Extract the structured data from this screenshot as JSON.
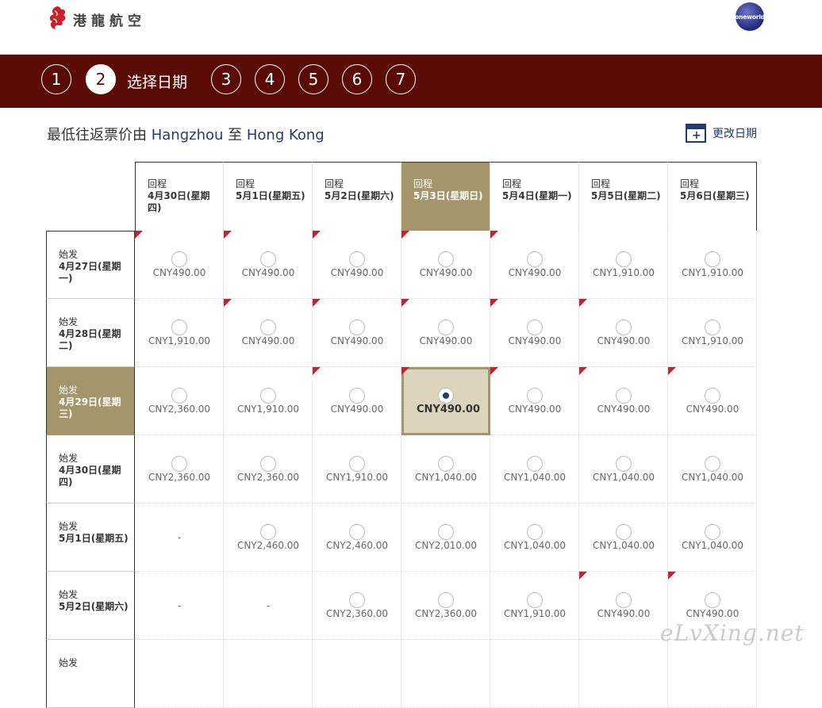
{
  "header": {
    "logo_text": "港龍航空",
    "alliance_badge": "oneworld"
  },
  "steps": {
    "items": [
      "1",
      "2",
      "3",
      "4",
      "5",
      "6",
      "7"
    ],
    "active_index": 1,
    "active_label": "选择日期"
  },
  "subtitle": {
    "prefix": "最低往返票价由 ",
    "origin": "Hangzhou",
    "middle": " 至 ",
    "destination": "Hong Kong"
  },
  "change_date": {
    "label": "更改日期",
    "icon": "calendar-plus-icon"
  },
  "grid": {
    "return_label": "回程",
    "depart_label": "始发",
    "return_dates": [
      "4月30日(星期四)",
      "5月1日(星期五)",
      "5月2日(星期六)",
      "5月3日(星期日)",
      "5月4日(星期一)",
      "5月5日(星期二)",
      "5月6日(星期三)"
    ],
    "depart_dates": [
      "4月27日(星期一)",
      "4月28日(星期二)",
      "4月29日(星期三)",
      "4月30日(星期四)",
      "5月1日(星期五)",
      "5月2日(星期六)",
      ""
    ],
    "selected_return_col": 3,
    "selected_depart_row": 2,
    "prices": [
      [
        "CNY490.00",
        "CNY490.00",
        "CNY490.00",
        "CNY490.00",
        "CNY490.00",
        "CNY1,910.00",
        "CNY1,910.00"
      ],
      [
        "CNY1,910.00",
        "CNY490.00",
        "CNY490.00",
        "CNY490.00",
        "CNY490.00",
        "CNY490.00",
        "CNY1,910.00"
      ],
      [
        "CNY2,360.00",
        "CNY1,910.00",
        "CNY490.00",
        "CNY490.00",
        "CNY490.00",
        "CNY490.00",
        "CNY490.00"
      ],
      [
        "CNY2,360.00",
        "CNY2,360.00",
        "CNY1,910.00",
        "CNY1,040.00",
        "CNY1,040.00",
        "CNY1,040.00",
        "CNY1,040.00"
      ],
      [
        "-",
        "CNY2,460.00",
        "CNY2,460.00",
        "CNY2,010.00",
        "CNY1,040.00",
        "CNY1,040.00",
        "CNY1,040.00"
      ],
      [
        "-",
        "-",
        "CNY2,360.00",
        "CNY2,360.00",
        "CNY1,910.00",
        "CNY490.00",
        "CNY490.00"
      ],
      [
        "",
        "",
        "",
        "",
        "",
        "",
        ""
      ]
    ],
    "lowest_fare_flags": [
      [
        true,
        true,
        true,
        true,
        true,
        false,
        false
      ],
      [
        false,
        true,
        true,
        true,
        true,
        true,
        false
      ],
      [
        false,
        false,
        true,
        true,
        true,
        true,
        true
      ],
      [
        false,
        false,
        false,
        false,
        false,
        false,
        false
      ],
      [
        false,
        false,
        false,
        false,
        false,
        false,
        false
      ],
      [
        false,
        false,
        false,
        false,
        false,
        true,
        true
      ],
      [
        false,
        false,
        false,
        false,
        false,
        false,
        false
      ]
    ]
  },
  "colors": {
    "brand_maroon": "#5a0b05",
    "selected_gold": "#a4956b",
    "selected_cell": "#ddd4bd",
    "link_blue": "#243a6b",
    "flag_red": "#c8202c"
  },
  "watermark": "eLvXing.net"
}
